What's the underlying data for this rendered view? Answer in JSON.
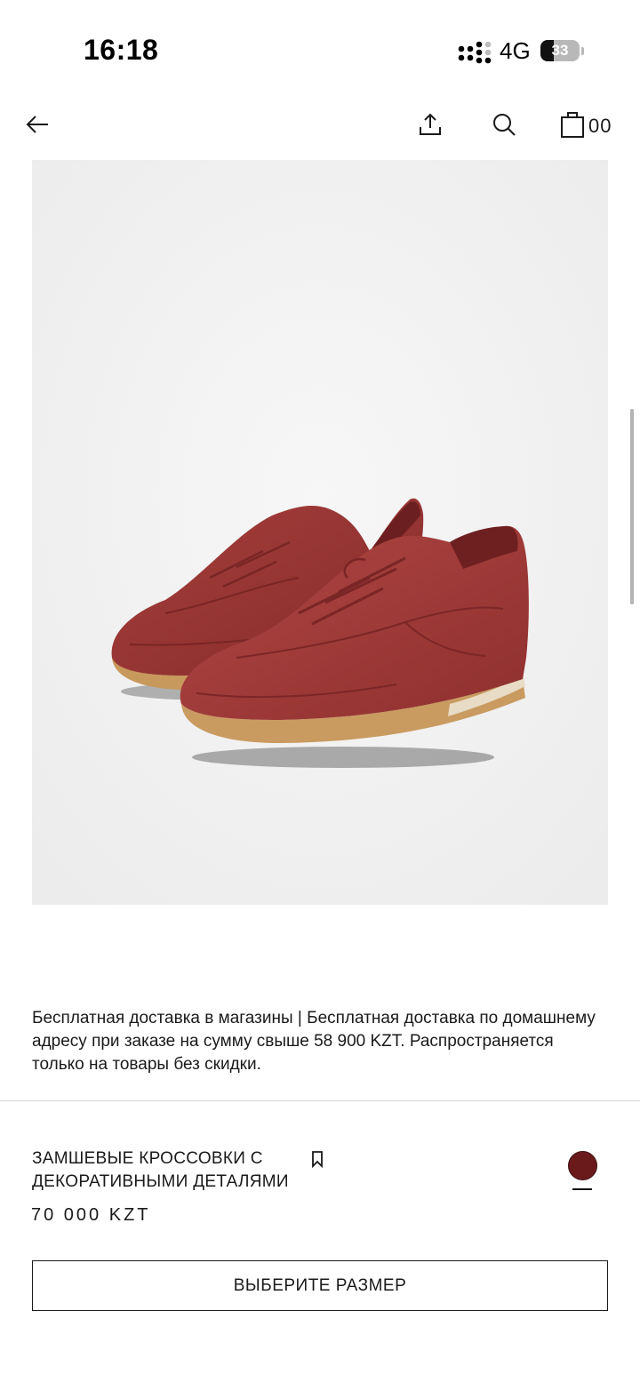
{
  "status_bar": {
    "time": "16:18",
    "network": "4G",
    "battery": "33",
    "battery_level": 0.33
  },
  "nav": {
    "cart_count": "00"
  },
  "product_image": {
    "alt": "Замшевые кроссовки с декоративными деталями",
    "shoe_color": "#a03a38"
  },
  "shipping": {
    "text": "Бесплатная доставка в магазины  |  Бесплатная доставка по домашнему адресу при заказе на сумму свыше 58 900 KZT. Распространяется только на товары без скидки."
  },
  "product": {
    "title": "ЗАМШЕВЫЕ КРОССОВКИ С ДЕКОРАТИВНЫМИ ДЕТАЛЯМИ",
    "price": "70 000 KZT",
    "selected_color": "#6b1a1c"
  },
  "actions": {
    "select_size": "ВЫБЕРИТЕ РАЗМЕР"
  }
}
